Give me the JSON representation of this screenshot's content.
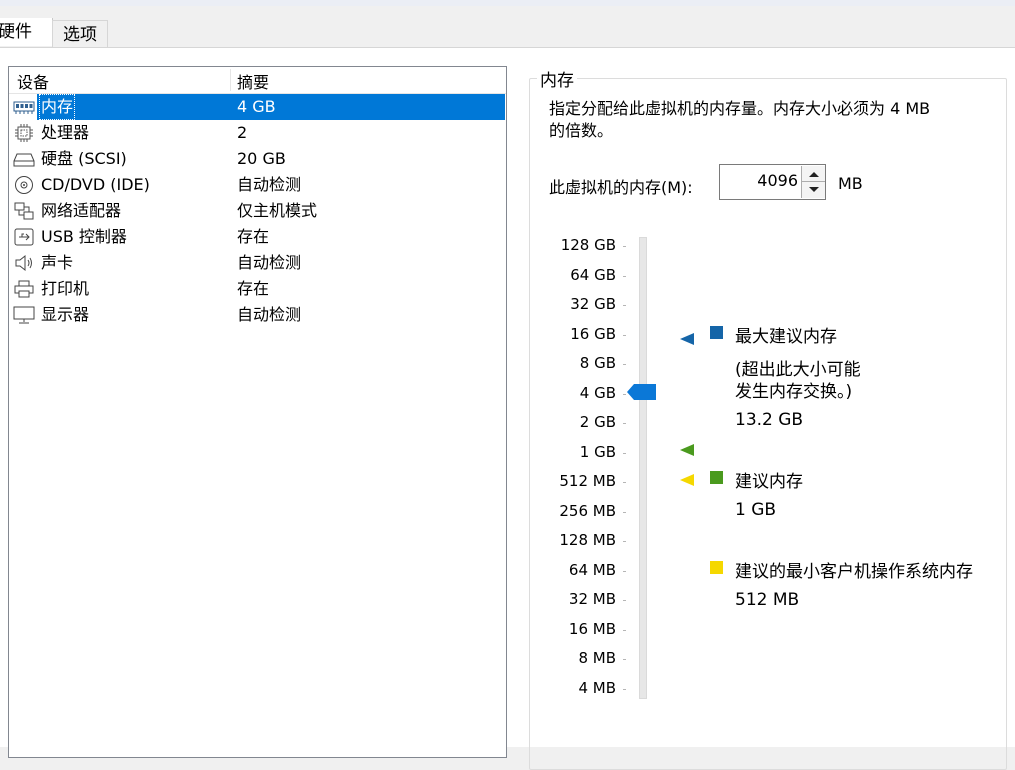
{
  "tabs": [
    {
      "label": "硬件",
      "active": true
    },
    {
      "label": "选项",
      "active": false
    }
  ],
  "device_list": {
    "columns": [
      "设备",
      "摘要"
    ],
    "rows": [
      {
        "icon": "memory-icon",
        "name": "内存",
        "summary": "4 GB",
        "selected": true
      },
      {
        "icon": "processor-icon",
        "name": "处理器",
        "summary": "2",
        "selected": false
      },
      {
        "icon": "harddisk-icon",
        "name": "硬盘 (SCSI)",
        "summary": "20 GB",
        "selected": false
      },
      {
        "icon": "cd-dvd-icon",
        "name": "CD/DVD (IDE)",
        "summary": "自动检测",
        "selected": false
      },
      {
        "icon": "network-adapter-icon",
        "name": "网络适配器",
        "summary": "仅主机模式",
        "selected": false
      },
      {
        "icon": "usb-icon",
        "name": "USB 控制器",
        "summary": "存在",
        "selected": false
      },
      {
        "icon": "sound-icon",
        "name": "声卡",
        "summary": "自动检测",
        "selected": false
      },
      {
        "icon": "printer-icon",
        "name": "打印机",
        "summary": "存在",
        "selected": false
      },
      {
        "icon": "display-icon",
        "name": "显示器",
        "summary": "自动检测",
        "selected": false
      }
    ]
  },
  "memory": {
    "group_title": "内存",
    "description_line1": "指定分配给此虚拟机的内存量。内存大小必须为 4 MB",
    "description_line2": "的倍数。",
    "field_label": "此虚拟机的内存(M):",
    "value": "4096",
    "unit": "MB",
    "scale_labels": [
      "128 GB",
      "64 GB",
      "32 GB",
      "16 GB",
      "8 GB",
      "4 GB",
      "2 GB",
      "1 GB",
      "512 MB",
      "256 MB",
      "128 MB",
      "64 MB",
      "32 MB",
      "16 MB",
      "8 MB",
      "4 MB"
    ],
    "current_level": "4 GB",
    "legend": {
      "max_title": "最大建议内存",
      "max_note_line1": "(超出此大小可能",
      "max_note_line2": "发生内存交换。)",
      "max_value": "13.2 GB",
      "recommended_title": "建议内存",
      "recommended_value": "1 GB",
      "min_title": "建议的最小客户机操作系统内存",
      "min_value": "512 MB"
    },
    "colors": {
      "max": "#1565a8",
      "recommended": "#4a9a1e",
      "min": "#f5d800",
      "thumb": "#0b78d7"
    }
  }
}
